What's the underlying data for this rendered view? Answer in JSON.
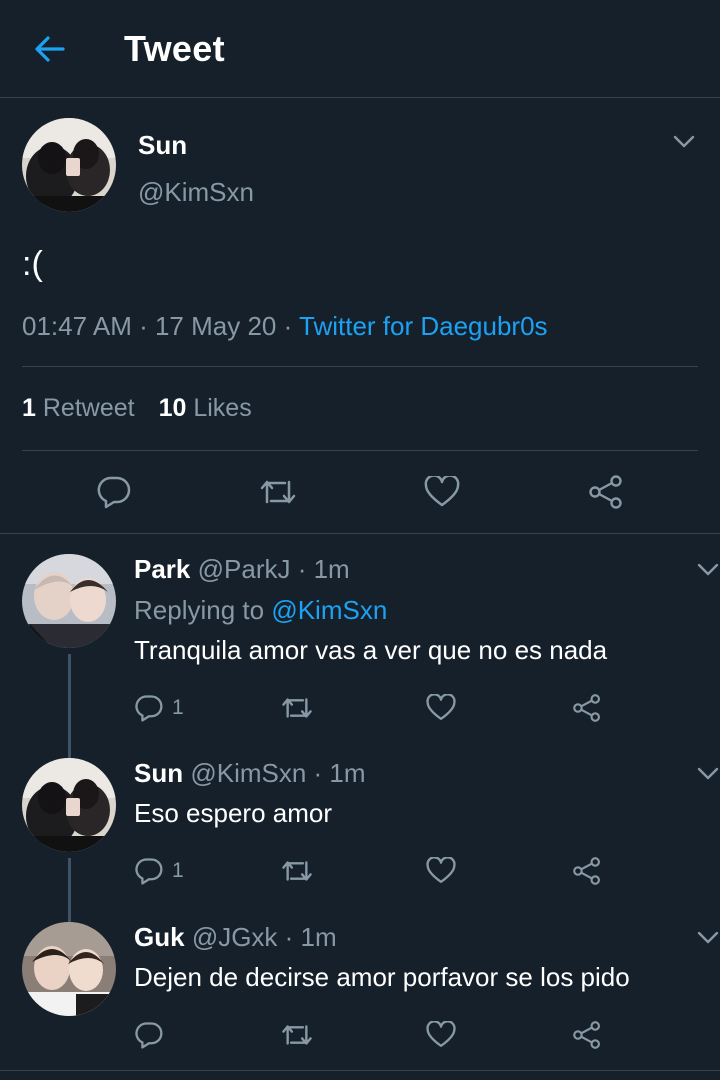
{
  "header": {
    "title": "Tweet"
  },
  "main_tweet": {
    "name": "Sun",
    "handle": "@KimSxn",
    "text": ":(",
    "time": "01:47 AM · 17 May 20 · ",
    "source": "Twitter for Daegubr0s",
    "retweets_count": "1",
    "retweets_label": "Retweet",
    "likes_count": "10",
    "likes_label": "Likes"
  },
  "replies": [
    {
      "name": "Park",
      "meta": "@ParkJ · 1m",
      "replying_prefix": "Replying to ",
      "replying_to": "@KimSxn",
      "text": "Tranquila amor vas a ver que no es nada",
      "reply_count": "1"
    },
    {
      "name": "Sun",
      "meta": "@KimSxn · 1m",
      "text": "Eso espero amor",
      "reply_count": "1"
    },
    {
      "name": "Guk",
      "meta": "@JGxk · 1m",
      "text": "Dejen de decirse amor porfavor se los pido",
      "reply_count": ""
    }
  ],
  "colors": {
    "background": "#15202b",
    "accent": "#1da1f2",
    "secondary_text": "#8899a6",
    "divider": "#38444d"
  }
}
